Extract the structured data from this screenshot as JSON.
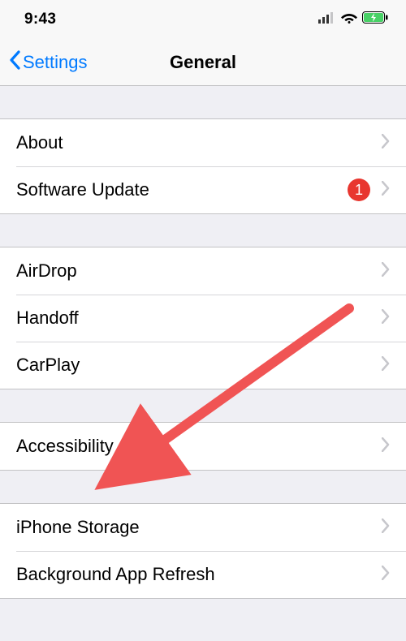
{
  "status": {
    "time": "9:43"
  },
  "nav": {
    "back_label": "Settings",
    "title": "General"
  },
  "groups": [
    {
      "items": [
        {
          "label": "About",
          "badge": null
        },
        {
          "label": "Software Update",
          "badge": "1"
        }
      ]
    },
    {
      "items": [
        {
          "label": "AirDrop",
          "badge": null
        },
        {
          "label": "Handoff",
          "badge": null
        },
        {
          "label": "CarPlay",
          "badge": null
        }
      ]
    },
    {
      "items": [
        {
          "label": "Accessibility",
          "badge": null
        }
      ]
    },
    {
      "items": [
        {
          "label": "iPhone Storage",
          "badge": null
        },
        {
          "label": "Background App Refresh",
          "badge": null
        }
      ]
    }
  ],
  "annotation": {
    "arrow_color": "#f05454"
  }
}
